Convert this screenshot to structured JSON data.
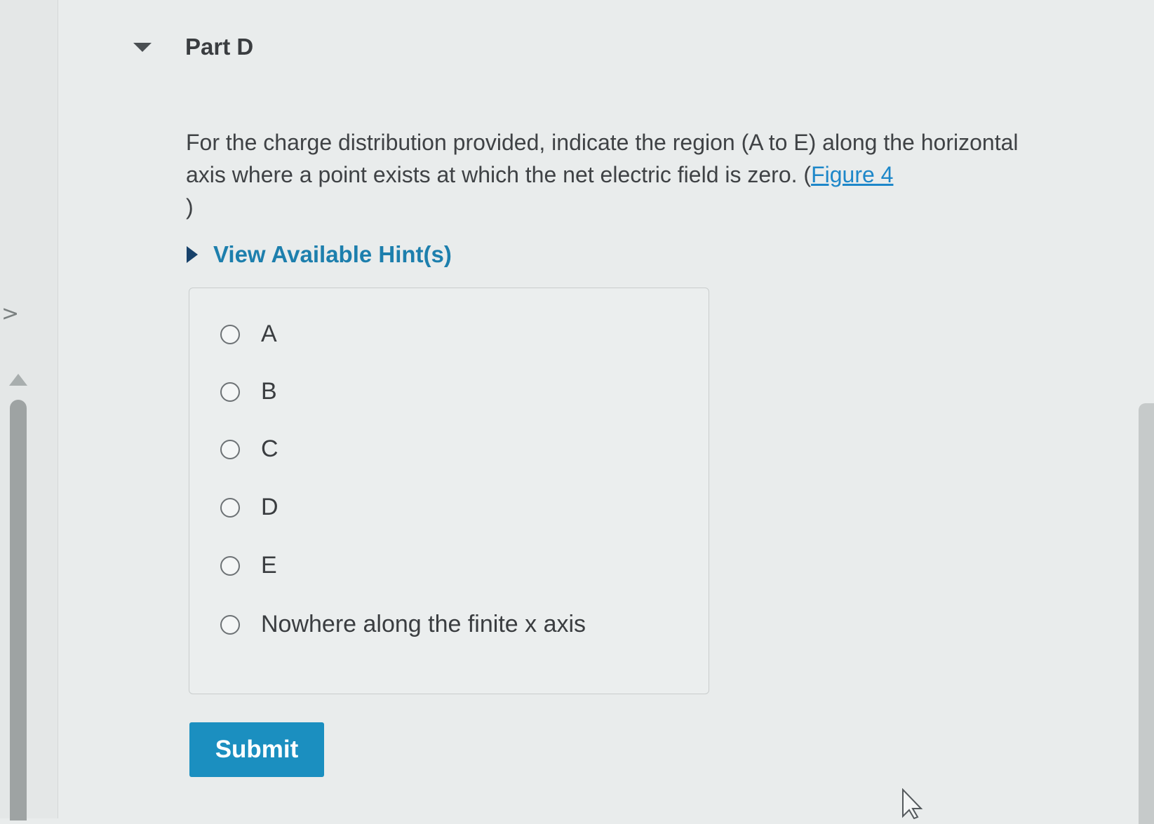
{
  "part": {
    "title": "Part D"
  },
  "question": {
    "text": "For the charge distribution provided, indicate the region (A to E) along the horizontal axis where a point exists at which the net electric field is zero. (",
    "figure_link": "Figure 4",
    "closing": ")"
  },
  "hints": {
    "label": "View Available Hint(s)"
  },
  "choices": [
    {
      "label": "A"
    },
    {
      "label": "B"
    },
    {
      "label": "C"
    },
    {
      "label": "D"
    },
    {
      "label": "E"
    },
    {
      "label": "Nowhere along the finite x axis"
    }
  ],
  "submit": {
    "label": "Submit"
  },
  "colors": {
    "accent": "#1b8fc0",
    "link": "#1d87c9",
    "hint_text": "#1d7fad"
  },
  "icons": {
    "collapse": "triangle-down-icon",
    "hint_expand": "triangle-right-icon",
    "gutter": "chevron-right-icon",
    "cursor": "mouse-pointer-icon"
  }
}
